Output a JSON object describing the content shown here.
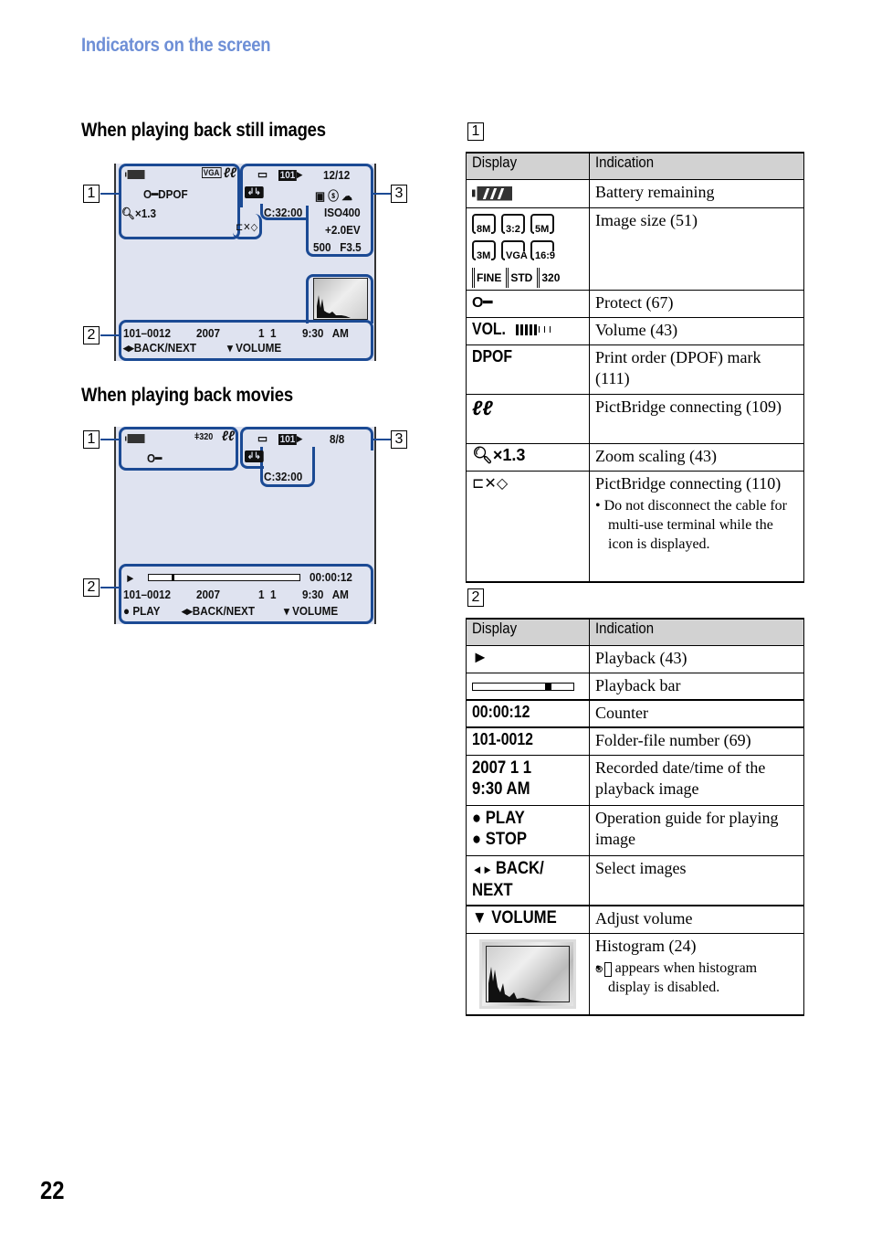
{
  "page": {
    "section_title": "Indicators on the screen",
    "page_number": "22"
  },
  "still_images": {
    "heading": "When playing back still images",
    "callouts": [
      "1",
      "2",
      "3"
    ],
    "zone1": {
      "battery_icon": "battery-icon",
      "image_size": "VGA",
      "protect_dpof": "DPOF",
      "zoom": "×1.3"
    },
    "zone3": {
      "folder": "101",
      "count": "12/12",
      "capacity": "C:32:00",
      "iso": "ISO400",
      "ev": "+2.0EV",
      "shutter_aperture": "500   F3.5"
    },
    "zone2": {
      "file": "101–0012",
      "year": "2007",
      "date": "1  1",
      "time": "9:30   AM",
      "nav": "BACK/NEXT",
      "volume": "VOLUME"
    }
  },
  "movies": {
    "heading": "When playing back movies",
    "callouts": [
      "1",
      "2",
      "3"
    ],
    "zone1": {
      "movie_size": "320"
    },
    "zone3": {
      "folder": "101",
      "count": "8/8",
      "capacity": "C:32:00"
    },
    "zone2": {
      "counter": "00:00:12",
      "progress_fraction": 0.15,
      "file": "101–0012",
      "year": "2007",
      "date": "1  1",
      "time": "9:30   AM",
      "play": "PLAY",
      "nav": "BACK/NEXT",
      "volume": "VOLUME"
    }
  },
  "table1": {
    "label": "1",
    "headers": [
      "Display",
      "Indication"
    ],
    "rows": [
      {
        "display": "battery-icon",
        "indication": "Battery remaining"
      },
      {
        "display": "image-size-icons",
        "sizes": [
          "8M",
          "3:2",
          "5M",
          "3M",
          "VGA",
          "16:9"
        ],
        "movie_sizes": [
          "FINE",
          "STD",
          "320"
        ],
        "indication": "Image size (51)"
      },
      {
        "display": "key-icon",
        "indication": "Protect (67)"
      },
      {
        "display": "VOL.",
        "volume_level": "5 of 8",
        "indication": "Volume (43)"
      },
      {
        "display": "DPOF",
        "indication": "Print order (DPOF) mark (111)"
      },
      {
        "display": "pictbridge-icon",
        "indication": "PictBridge connecting (109)"
      },
      {
        "display": "×1.3",
        "indication": "Zoom scaling (43)"
      },
      {
        "display": "pictbridge-disconnect-icon",
        "indication": "PictBridge connecting (110)",
        "note": "Do not disconnect the cable for multi-use terminal while the icon is displayed."
      }
    ]
  },
  "table2": {
    "label": "2",
    "headers": [
      "Display",
      "Indication"
    ],
    "rows": [
      {
        "display": "play-icon",
        "indication": "Playback (43)"
      },
      {
        "display": "playback-bar",
        "progress_fraction": 0.72,
        "indication": "Playback bar"
      },
      {
        "display": "00:00:12",
        "indication": "Counter"
      },
      {
        "display": "101-0012",
        "indication": "Folder-file number (69)"
      },
      {
        "display": "2007 1 1\n9:30 AM",
        "display_line1": "2007 1 1",
        "display_line2": "9:30 AM",
        "indication": "Recorded date/time of the playback image"
      },
      {
        "display_line1": "PLAY",
        "display_line2": "STOP",
        "indication": "Operation guide for playing image"
      },
      {
        "display_line1": "BACK/",
        "display_line2": "NEXT",
        "indication": "Select images"
      },
      {
        "display": "VOLUME",
        "indication": "Adjust volume"
      },
      {
        "display": "histogram-thumbnail",
        "indication": "Histogram (24)",
        "note": "appears when histogram display is disabled."
      }
    ]
  }
}
